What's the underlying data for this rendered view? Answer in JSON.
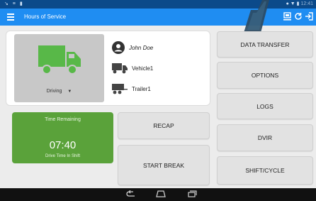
{
  "status_bar": {
    "left_icons": "↘ ≡ ▮",
    "right_icons": "● ▼ ▮",
    "time": "12:41"
  },
  "app_bar": {
    "title": "Hours of Service",
    "icons": [
      "edit-icon",
      "refresh-icon",
      "logout-icon"
    ]
  },
  "driver": {
    "name": "John Doe",
    "vehicle": "Vehicle1",
    "trailer": "Trailer1"
  },
  "duty_status": {
    "label": "Driving"
  },
  "time_remaining": {
    "label": "Time Remaining",
    "value": "07:40",
    "sub": "Drive Time In Shift"
  },
  "buttons": {
    "recap": "RECAP",
    "start_break": "START BREAK",
    "data_transfer": "DATA TRANSFER",
    "options": "OPTIONS",
    "logs": "LOGS",
    "dvir": "DVIR",
    "shift_cycle": "SHIFT/CYCLE"
  },
  "colors": {
    "app_bar": "#1f8df2",
    "status_bar": "#0b4a8a",
    "truck": "#58b848",
    "time_card": "#5aa23a"
  },
  "nav": {
    "icons": [
      "back-icon",
      "home-icon",
      "recent-apps-icon"
    ]
  }
}
